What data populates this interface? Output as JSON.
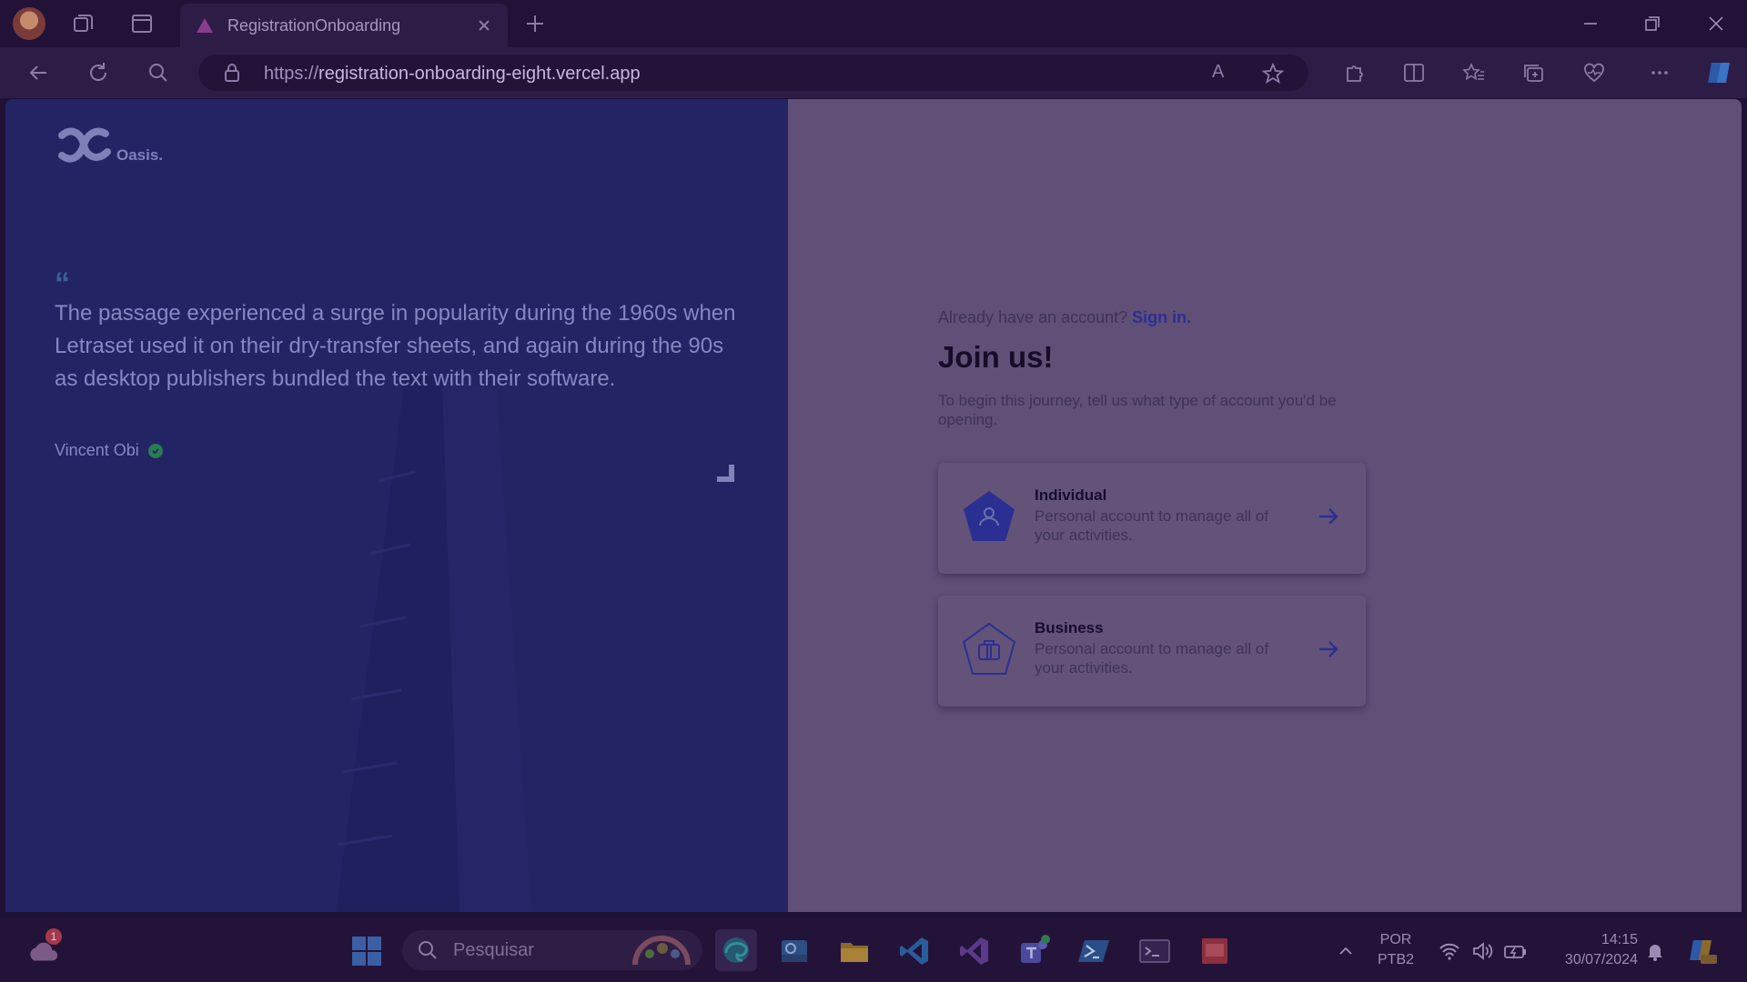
{
  "browser": {
    "tab_title": "RegistrationOnboarding",
    "url_scheme": "https://",
    "url_host": "registration-onboarding-eight.vercel.app",
    "read_aloud_label": "A"
  },
  "page": {
    "logo_text": "Oasis.",
    "quote": "The passage experienced a surge in popularity during the 1960s when Letraset used it on their dry-transfer sheets, and again during the 90s as desktop publishers bundled the text with their software.",
    "quote_author": "Vincent Obi",
    "signin_prompt": "Already have an account?",
    "signin_link": "Sign in.",
    "title": "Join us!",
    "description": "To begin this journey, tell us what type of account you'd be opening.",
    "accounts": [
      {
        "title": "Individual",
        "description": "Personal account to manage all of your activities.",
        "icon": "user-pentagon-icon"
      },
      {
        "title": "Business",
        "description": "Personal account to manage all of your activities.",
        "icon": "briefcase-pentagon-icon"
      }
    ]
  },
  "taskbar": {
    "search_placeholder": "Pesquisar",
    "weather_badge": "1",
    "language_top": "POR",
    "language_bottom": "PTB2",
    "time": "14:15",
    "date": "30/07/2024"
  },
  "colors": {
    "left_panel": "#222464",
    "right_panel": "#604f76",
    "link": "#2b2f92"
  }
}
